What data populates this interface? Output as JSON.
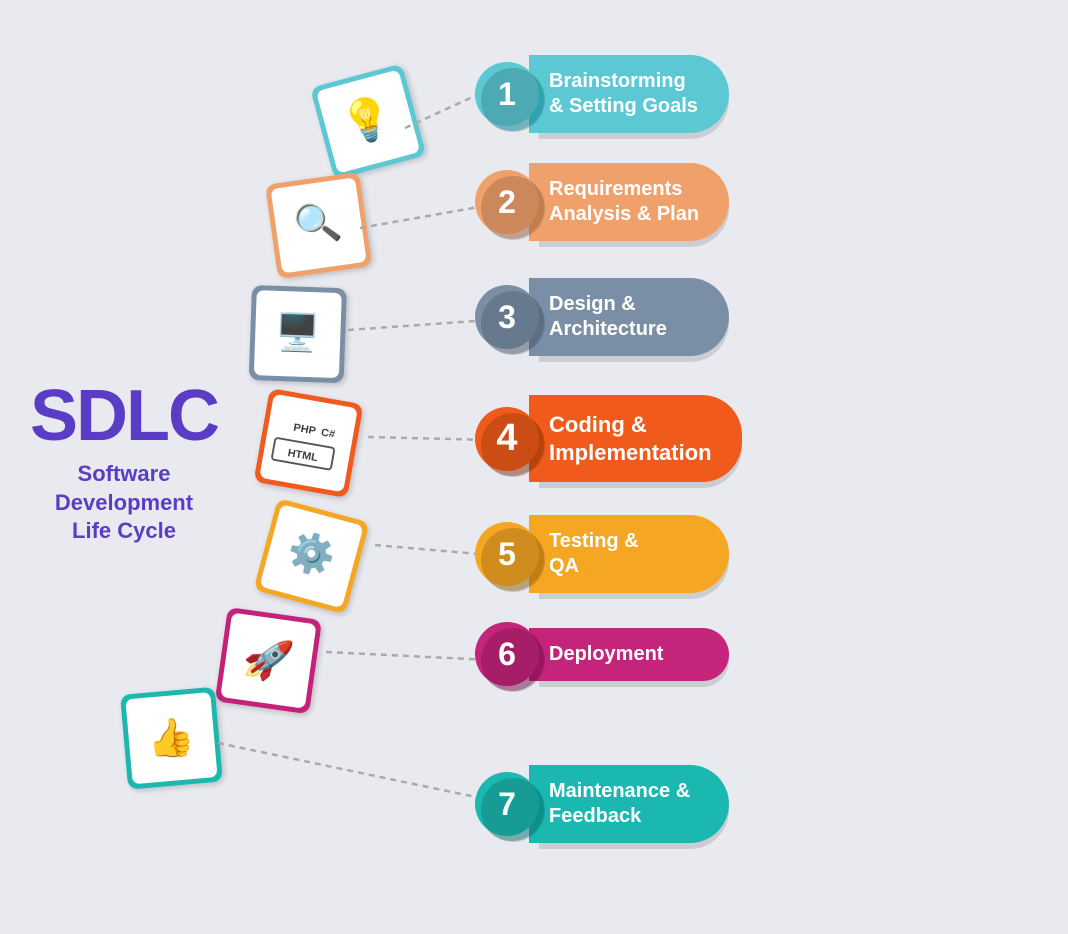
{
  "title": "SDLC",
  "subtitle_line1": "Software",
  "subtitle_line2": "Development",
  "subtitle_line3": "Life Cycle",
  "steps": [
    {
      "number": "1",
      "label_line1": "Brainstorming",
      "label_line2": "& Setting Goals",
      "color_circle": "#5bc8d4",
      "color_pill": "#5bc8d4",
      "icon": "💡",
      "class": "step1"
    },
    {
      "number": "2",
      "label_line1": "Requirements",
      "label_line2": "Analysis & Plan",
      "color_circle": "#f0a06a",
      "color_pill": "#f0a06a",
      "icon": "🔍",
      "class": "step2"
    },
    {
      "number": "3",
      "label_line1": "Design &",
      "label_line2": "Architecture",
      "color_circle": "#7a8fa6",
      "color_pill": "#7a8fa6",
      "icon": "🖥️",
      "class": "step3"
    },
    {
      "number": "4",
      "label_line1": "Coding &",
      "label_line2": "Implementation",
      "color_circle": "#f05a1a",
      "color_pill": "#f05a1a",
      "icon": "💻",
      "class": "step4"
    },
    {
      "number": "5",
      "label_line1": "Testing &",
      "label_line2": "QA",
      "color_circle": "#f5a623",
      "color_pill": "#f5a623",
      "icon": "⚙️",
      "class": "step5"
    },
    {
      "number": "6",
      "label_line1": "Deployment",
      "label_line2": "",
      "color_circle": "#c4247a",
      "color_pill": "#c4247a",
      "icon": "🚀",
      "class": "step6"
    },
    {
      "number": "7",
      "label_line1": "Maintenance &",
      "label_line2": "Feedback",
      "color_circle": "#1ab8b0",
      "color_pill": "#1ab8b0",
      "icon": "👍",
      "class": "step7"
    }
  ]
}
